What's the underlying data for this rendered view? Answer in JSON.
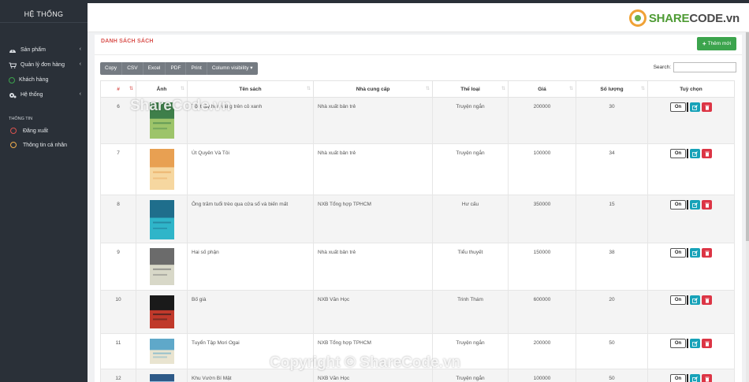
{
  "sidebar": {
    "brand": "HỆ THỐNG",
    "items": [
      {
        "label": "Sản phẩm",
        "icon": "dashboard-icon",
        "arrow": "‹"
      },
      {
        "label": "Quản lý đơn hàng",
        "icon": "cart-icon",
        "arrow": "‹"
      },
      {
        "label": "Khách hàng",
        "icon": "circle-green-icon"
      },
      {
        "label": "Hệ thống",
        "icon": "gear-icon",
        "arrow": "‹"
      }
    ],
    "section": "THÔNG TIN",
    "sub_items": [
      {
        "label": "Đăng xuất",
        "ring": "#d9534f"
      },
      {
        "label": "Thông tin cá nhân",
        "ring": "#f0ad4e"
      }
    ]
  },
  "header": {
    "logo_share": "SHARE",
    "logo_code": "CODE.vn"
  },
  "panel": {
    "title": "DANH SÁCH SÁCH",
    "add_button": "Thêm mới"
  },
  "toolbar": [
    "Copy",
    "CSV",
    "Excel",
    "PDF",
    "Print",
    "Column visibility ▾"
  ],
  "search": {
    "label": "Search:",
    "value": ""
  },
  "table": {
    "headers": [
      "#",
      "Ảnh",
      "Tên sách",
      "Nhà cung cấp",
      "Thể loại",
      "Giá",
      "Số lượng",
      "Tuỳ chọn"
    ],
    "rows": [
      {
        "id": "6",
        "title": "Tôi thấy hoa vàng trên cỏ xanh",
        "supplier": "Nhà xuất bản trẻ",
        "genre": "Truyện ngắn",
        "price": "200000",
        "qty": "30",
        "toggle": "On",
        "cover": [
          "#3e7f4a",
          "#9dc46a"
        ]
      },
      {
        "id": "7",
        "title": "Út Quyên Và Tôi",
        "supplier": "Nhà xuất bản trẻ",
        "genre": "Truyện ngắn",
        "price": "100000",
        "qty": "34",
        "toggle": "On",
        "cover": [
          "#e8a052",
          "#f6d7a0"
        ]
      },
      {
        "id": "8",
        "title": "Ông trăm tuổi trèo qua cửa sổ và biến mất",
        "supplier": "NXB Tổng hợp TPHCM",
        "genre": "Hư cấu",
        "price": "350000",
        "qty": "15",
        "toggle": "On",
        "cover": [
          "#1f6e8c",
          "#2fb5c9"
        ]
      },
      {
        "id": "9",
        "title": "Hai số phận",
        "supplier": "Nhà xuất bản trẻ",
        "genre": "Tiểu thuyết",
        "price": "150000",
        "qty": "38",
        "toggle": "On",
        "cover": [
          "#6b6b6b",
          "#d8d8c8"
        ]
      },
      {
        "id": "10",
        "title": "Bố già",
        "supplier": "NXB Văn Học",
        "genre": "Trinh Thám",
        "price": "600000",
        "qty": "20",
        "toggle": "On",
        "cover": [
          "#1a1a1a",
          "#c0392b"
        ]
      },
      {
        "id": "11",
        "title": "Tuyển Tập Mori Ogai",
        "supplier": "NXB Tổng hợp TPHCM",
        "genre": "Truyện ngắn",
        "price": "200000",
        "qty": "50",
        "toggle": "On",
        "cover": [
          "#5fa8c9",
          "#e9e4d0"
        ]
      },
      {
        "id": "12",
        "title": "Khu Vườn Bí Mật",
        "supplier": "NXB Văn Học",
        "genre": "Truyện ngắn",
        "price": "100000",
        "qty": "50",
        "toggle": "On",
        "cover": [
          "#2e5a88",
          "#9cc0de"
        ]
      }
    ]
  },
  "watermarks": {
    "top": "ShareCode.vn",
    "bottom": "Copyright © ShareCode.vn"
  },
  "colors": {
    "sidebar_bg": "#2a3038",
    "title_red": "#d9534f",
    "add_green": "#3ca44d",
    "edit_teal": "#17a2b8",
    "delete_red": "#dc3545"
  }
}
